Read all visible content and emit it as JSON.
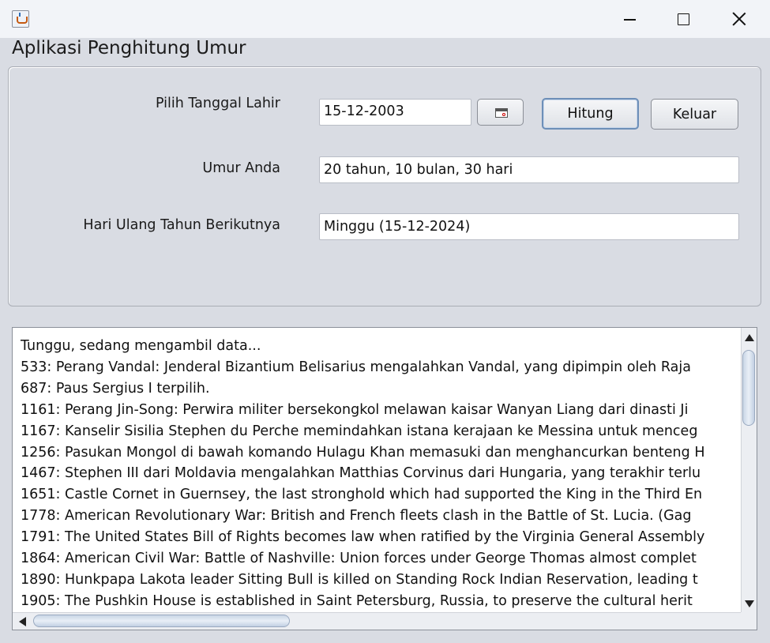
{
  "window": {
    "title": "",
    "icon": "java-cup-icon",
    "controls": {
      "minimize": "minimize-icon",
      "maximize": "maximize-icon",
      "close": "close-icon"
    }
  },
  "app": {
    "heading": "Aplikasi Penghitung Umur"
  },
  "form": {
    "birth_label": "Pilih Tanggal Lahir",
    "birth_value": "15-12-2003",
    "calendar_button_icon": "calendar-icon",
    "hitung_label": "Hitung",
    "keluar_label": "Keluar",
    "age_label": "Umur Anda",
    "age_value": "20 tahun, 10 bulan, 30 hari",
    "next_birthday_label": "Hari Ulang Tahun Berikutnya",
    "next_birthday_value": "Minggu (15-12-2024)"
  },
  "log": {
    "lines": [
      "Tunggu, sedang mengambil data...",
      "533: Perang Vandal: Jenderal Bizantium Belisarius mengalahkan Vandal, yang dipimpin oleh Raja",
      "687: Paus Sergius I terpilih.",
      "1161: Perang Jin-Song: Perwira militer bersekongkol melawan kaisar Wanyan Liang dari dinasti Ji",
      "1167: Kanselir Sisilia Stephen du Perche memindahkan istana kerajaan ke Messina untuk menceg",
      "1256: Pasukan Mongol di bawah komando Hulagu Khan memasuki dan menghancurkan benteng H",
      "1467: Stephen III dari Moldavia mengalahkan Matthias Corvinus dari Hungaria, yang terakhir terlu",
      "1651: Castle Cornet in Guernsey, the last stronghold which had supported the King in the Third En",
      "1778: American Revolutionary War: British and French fleets clash in the Battle of St. Lucia. (Gag",
      "1791: The United States Bill of Rights becomes law when ratified by the Virginia General Assembly",
      "1864: American Civil War: Battle of Nashville: Union forces under George Thomas almost complet",
      "1890: Hunkpapa Lakota leader Sitting Bull is killed on Standing Rock Indian Reservation, leading t",
      "1905: The Pushkin House is established in Saint Petersburg, Russia, to preserve the cultural herit"
    ]
  },
  "colors": {
    "window_bg": "#d9dce3",
    "titlebar_bg": "#f2f4f8",
    "focus_border": "#6d8fb8"
  }
}
